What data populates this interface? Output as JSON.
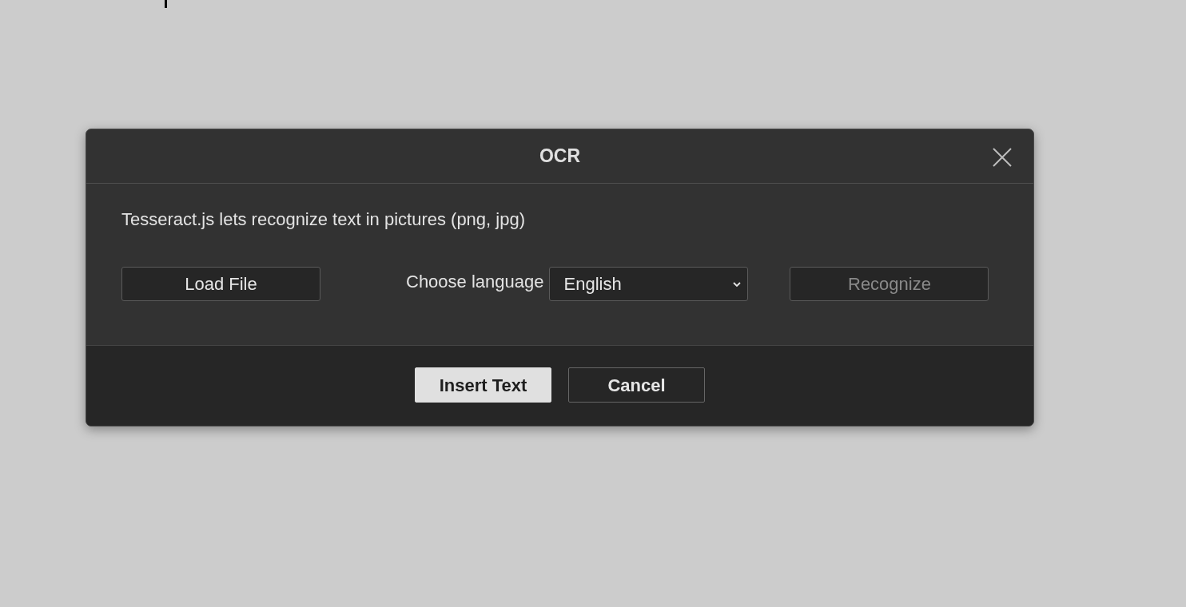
{
  "dialog": {
    "title": "OCR",
    "description": "Tesseract.js lets recognize text in pictures (png, jpg)",
    "load_button": {
      "label": "Load File",
      "disabled": false
    },
    "language": {
      "label": "Choose language",
      "value": "English"
    },
    "recognize_button": {
      "label": "Recognize",
      "disabled": true
    },
    "footer_buttons": [
      {
        "label": "Insert Text",
        "kind": "primary"
      },
      {
        "label": "Cancel",
        "kind": "secondary"
      }
    ]
  }
}
